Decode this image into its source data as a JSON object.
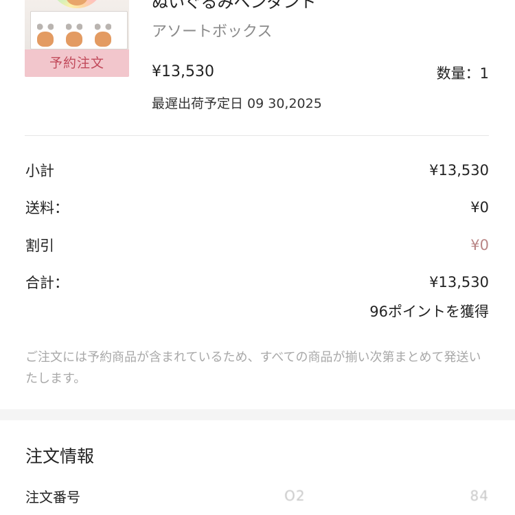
{
  "product": {
    "thumbnail_badge": "予約注文",
    "name": "ぬいぐるみペンダント",
    "variant": "アソートボックス",
    "price": "¥13,530",
    "quantity_label": "数量：1",
    "ship_date_label": "最遅出荷予定日 09 30,2025"
  },
  "summary": {
    "subtotal_label": "小計",
    "subtotal_value": "¥13,530",
    "shipping_label": "送料：",
    "shipping_value": "¥0",
    "discount_label": "割引",
    "discount_value": "¥0",
    "total_label": "合計：",
    "total_value": "¥13,530",
    "points_text": "96ポイントを獲得"
  },
  "note": "ご注文には予約商品が含まれているため、すべての商品が揃い次第まとめて発送いたします。",
  "order_info": {
    "title": "注文情報",
    "order_number_label": "注文番号",
    "order_number_start": "O2",
    "order_number_end": "84"
  },
  "colors": {
    "discount": "#b98585",
    "badge_bg": "#f2c6cc",
    "badge_text": "#c1495a",
    "muted_text": "#a8a8a8"
  }
}
